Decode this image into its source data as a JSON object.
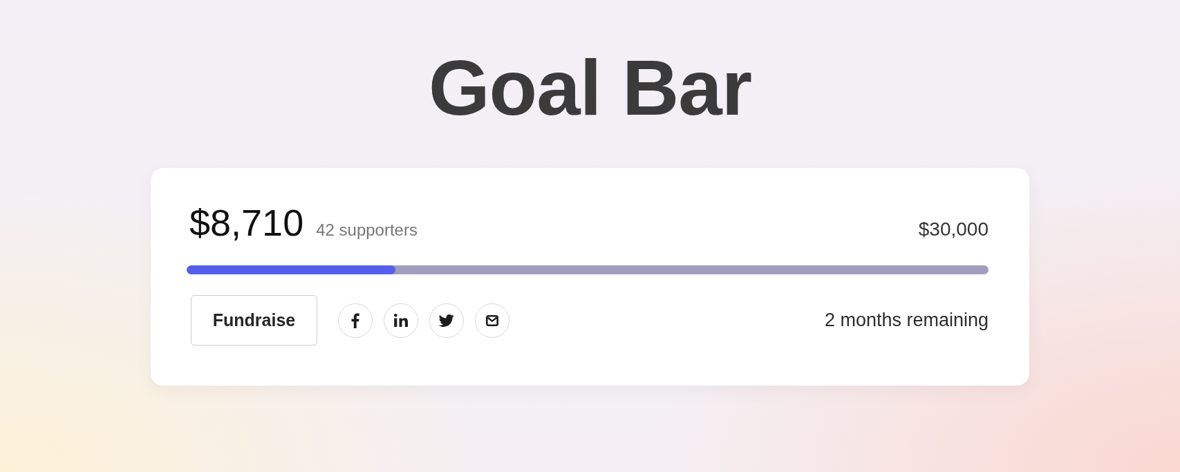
{
  "title": "Goal Bar",
  "goal_card": {
    "raised": "$8,710",
    "supporters": "42 supporters",
    "goal": "$30,000",
    "progress": {
      "level": 0.26
    },
    "button": "Fundraise",
    "share_buttons": [
      {
        "kind": "facebook"
      },
      {
        "kind": "linkedin"
      },
      {
        "kind": "twitter"
      },
      {
        "kind": "email"
      }
    ],
    "time_remaining": "2 months remaining"
  }
}
